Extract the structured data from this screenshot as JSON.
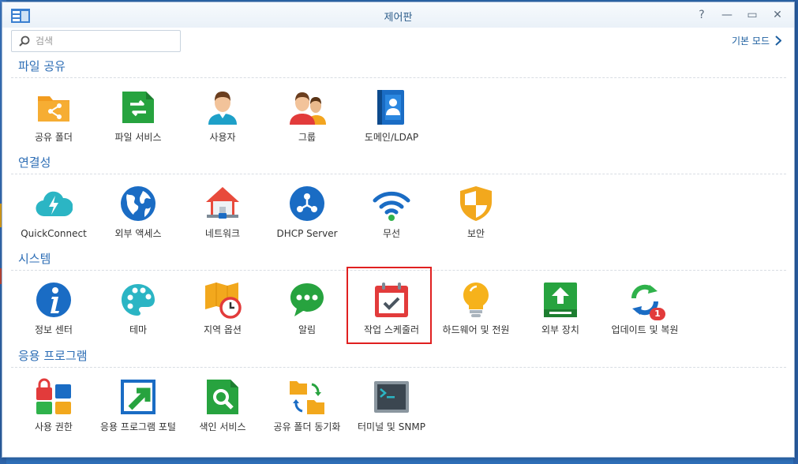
{
  "window": {
    "title": "제어판"
  },
  "titlebar_buttons": [
    {
      "name": "help-button",
      "glyph": "?"
    },
    {
      "name": "minimize-button",
      "glyph": "—"
    },
    {
      "name": "maximize-button",
      "glyph": "▭"
    },
    {
      "name": "close-button",
      "glyph": "✕"
    }
  ],
  "search": {
    "placeholder": "검색",
    "value": ""
  },
  "basic_mode": {
    "label": "기본 모드"
  },
  "sections": [
    {
      "title": "파일 공유",
      "items": [
        {
          "label": "공유 폴더",
          "icon": "shared-folder-icon"
        },
        {
          "label": "파일 서비스",
          "icon": "file-services-icon"
        },
        {
          "label": "사용자",
          "icon": "user-icon"
        },
        {
          "label": "그룹",
          "icon": "group-icon"
        },
        {
          "label": "도메인/LDAP",
          "icon": "domain-ldap-icon"
        }
      ]
    },
    {
      "title": "연결성",
      "items": [
        {
          "label": "QuickConnect",
          "icon": "quickconnect-icon"
        },
        {
          "label": "외부 액세스",
          "icon": "external-access-icon"
        },
        {
          "label": "네트워크",
          "icon": "network-icon"
        },
        {
          "label": "DHCP Server",
          "icon": "dhcp-server-icon"
        },
        {
          "label": "무선",
          "icon": "wireless-icon"
        },
        {
          "label": "보안",
          "icon": "security-shield-icon"
        }
      ]
    },
    {
      "title": "시스템",
      "items": [
        {
          "label": "정보 센터",
          "icon": "info-center-icon"
        },
        {
          "label": "테마",
          "icon": "theme-palette-icon"
        },
        {
          "label": "지역 옵션",
          "icon": "regional-options-icon"
        },
        {
          "label": "알림",
          "icon": "notification-icon"
        },
        {
          "label": "작업 스케줄러",
          "icon": "task-scheduler-icon"
        },
        {
          "label": "하드웨어 및 전원",
          "icon": "hardware-power-icon"
        },
        {
          "label": "외부 장치",
          "icon": "external-devices-icon"
        },
        {
          "label": "업데이트 및 복원",
          "icon": "update-restore-icon",
          "badge": "1"
        }
      ]
    },
    {
      "title": "응용 프로그램",
      "items": [
        {
          "label": "사용 권한",
          "icon": "privileges-icon"
        },
        {
          "label": "응용 프로그램 포털",
          "icon": "application-portal-icon"
        },
        {
          "label": "색인 서비스",
          "icon": "indexing-service-icon"
        },
        {
          "label": "공유 폴더 동기화",
          "icon": "shared-folder-sync-icon"
        },
        {
          "label": "터미널 및 SNMP",
          "icon": "terminal-snmp-icon"
        }
      ]
    }
  ],
  "colors": {
    "accent": "#2c6db5",
    "highlight": "#e02020"
  }
}
